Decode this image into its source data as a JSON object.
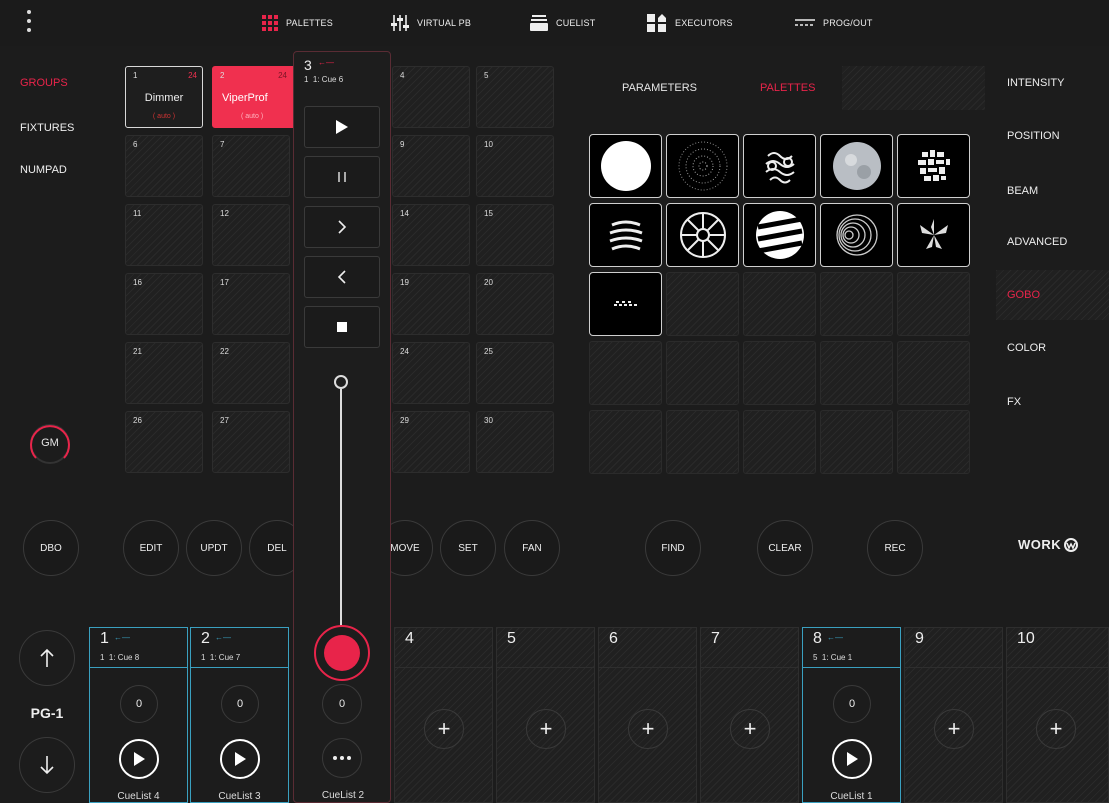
{
  "nav": {
    "tabs": [
      {
        "label": "PALETTES",
        "icon": "palette-grid-icon",
        "active": true
      },
      {
        "label": "VIRTUAL PB",
        "icon": "faders-icon"
      },
      {
        "label": "CUELIST",
        "icon": "cuelist-icon"
      },
      {
        "label": "EXECUTORS",
        "icon": "executors-icon"
      },
      {
        "label": "PROG/OUT",
        "icon": "prog-out-icon"
      }
    ]
  },
  "left": {
    "items": [
      {
        "label": "GROUPS",
        "active": true
      },
      {
        "label": "FIXTURES"
      },
      {
        "label": "NUMPAD"
      }
    ],
    "gm": "GM"
  },
  "groups": {
    "cell1": {
      "num": "1",
      "count": "24",
      "label": "Dimmer",
      "auto": "( auto )"
    },
    "cell2": {
      "num": "2",
      "count": "24",
      "label": "ViperProf",
      "auto": "( auto )"
    },
    "numbers": [
      "4",
      "5",
      "6",
      "7",
      "9",
      "10",
      "11",
      "12",
      "14",
      "15",
      "16",
      "17",
      "19",
      "20",
      "21",
      "22",
      "24",
      "25",
      "26",
      "27",
      "29",
      "30"
    ]
  },
  "palettes_header": {
    "parameters": "PARAMETERS",
    "palettes": "PALETTES"
  },
  "attributes": {
    "items": [
      {
        "label": "INTENSITY"
      },
      {
        "label": "POSITION"
      },
      {
        "label": "BEAM"
      },
      {
        "label": "ADVANCED"
      },
      {
        "label": "GOBO",
        "active": true
      },
      {
        "label": "COLOR"
      },
      {
        "label": "FX"
      }
    ]
  },
  "actions": {
    "dbo": "DBO",
    "edit": "EDIT",
    "updt": "UPDT",
    "del": "DEL",
    "move": "MOVE",
    "set": "SET",
    "fan": "FAN",
    "find": "FIND",
    "clear": "CLEAR",
    "rec": "REC"
  },
  "brand": "WORK",
  "cuelist_panel": {
    "number": "3",
    "meta": "1",
    "cue": "1: Cue 6",
    "fader_level": 0.0
  },
  "paging": {
    "page": "PG-1"
  },
  "executors": [
    {
      "num": "1",
      "meta": "1",
      "cue": "1: Cue 8",
      "knob": "0",
      "name": "CueList 4",
      "type": "cuelist"
    },
    {
      "num": "2",
      "meta": "1",
      "cue": "1: Cue 7",
      "knob": "0",
      "name": "CueList 3",
      "type": "cuelist"
    },
    {
      "num": "",
      "knob": "0",
      "name": "CueList 2",
      "type": "panel"
    },
    {
      "num": "4",
      "type": "empty"
    },
    {
      "num": "5",
      "type": "empty"
    },
    {
      "num": "6",
      "type": "empty"
    },
    {
      "num": "7",
      "type": "empty"
    },
    {
      "num": "8",
      "meta": "5",
      "cue": "1: Cue 1",
      "knob": "0",
      "name": "CueList 1",
      "type": "cuelist"
    },
    {
      "num": "9",
      "type": "empty"
    },
    {
      "num": "10",
      "type": "empty"
    }
  ],
  "colors": {
    "accent": "#e8244a",
    "active_exec": "#3aa0c0"
  }
}
